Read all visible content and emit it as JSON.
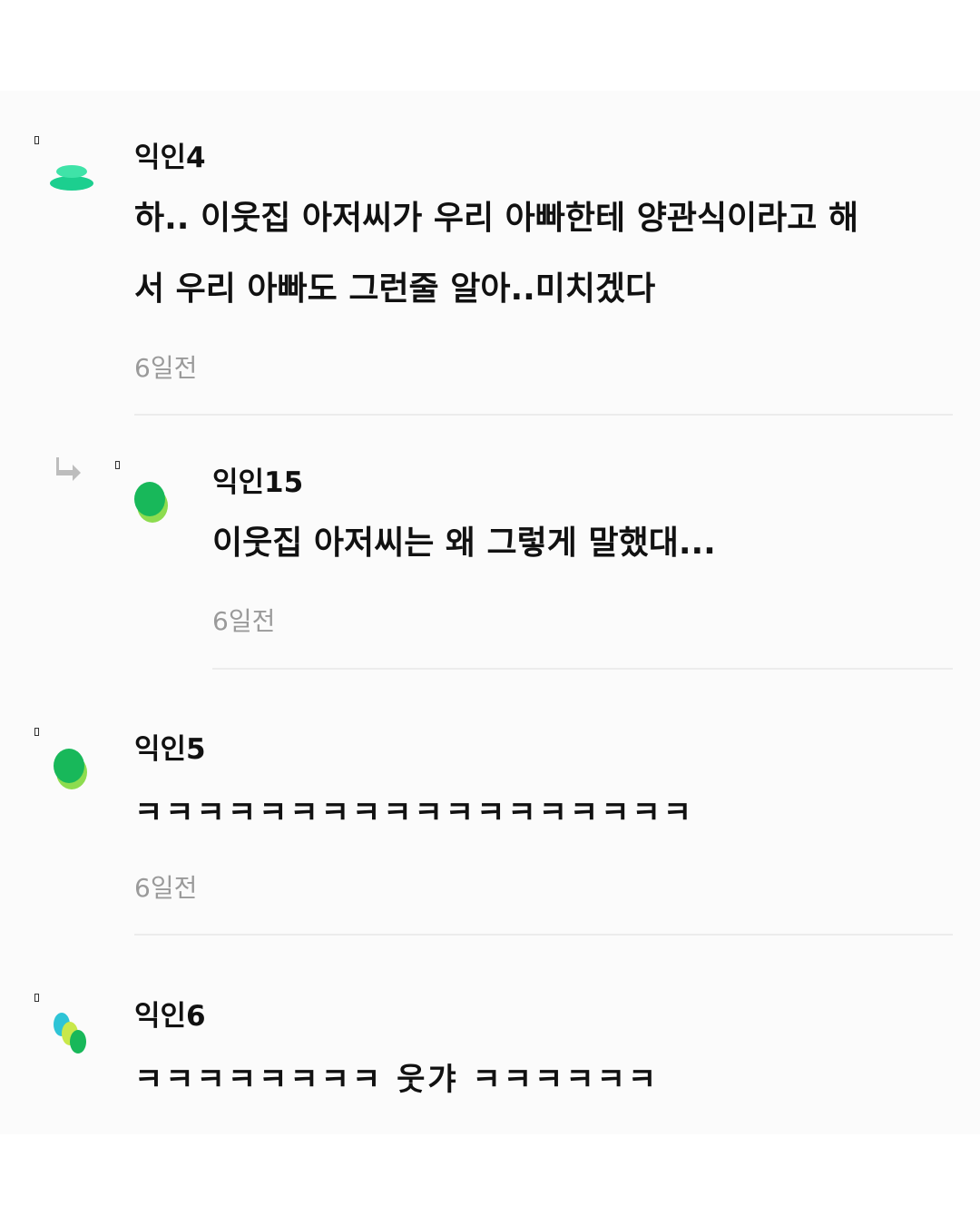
{
  "comments": [
    {
      "author": "익인4",
      "lines": [
        "하.. 이웃집 아저씨가 우리 아빠한테 양관식이라고 해",
        "서 우리 아빠도 그런줄 알아..미치겠다"
      ],
      "time": "6일전",
      "avatar_icon": "green-stack-avatar-icon"
    },
    {
      "author": "익인15",
      "lines": [
        "이웃집 아저씨는 왜 그렇게 말했대..."
      ],
      "time": "6일전",
      "is_reply": true,
      "avatar_icon": "green-leaf-avatar-icon"
    },
    {
      "author": "익인5",
      "lines": [
        "ㅋㅋㅋㅋㅋㅋㅋㅋㅋㅋㅋㅋㅋㅋㅋㅋㅋㅋ"
      ],
      "time": "6일전",
      "avatar_icon": "green-leaf-avatar-icon"
    },
    {
      "author": "익인6",
      "lines": [
        "ㅋㅋㅋㅋㅋㅋㅋㅋ 웃갸 ㅋㅋㅋㅋㅋㅋ"
      ],
      "avatar_icon": "multicolor-dots-avatar-icon"
    }
  ],
  "colors": {
    "avatar_teal": "#1ccf8f",
    "avatar_green": "#18b85a",
    "avatar_lime": "#8ddc4f",
    "avatar_cyan": "#2ec4d6",
    "time_gray": "#9a9a9a",
    "divider": "#ececec"
  },
  "icons": {
    "reply": "reply-arrow-icon"
  }
}
